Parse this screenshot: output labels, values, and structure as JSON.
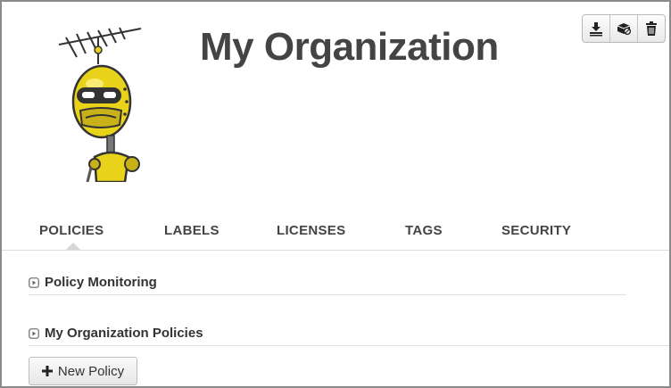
{
  "header": {
    "org_name": "My Organization"
  },
  "toolbar": {
    "icons": [
      "download-icon",
      "license-icon",
      "trash-icon"
    ]
  },
  "tabs": [
    {
      "label": "POLICIES",
      "active": true
    },
    {
      "label": "LABELS",
      "active": false
    },
    {
      "label": "LICENSES",
      "active": false
    },
    {
      "label": "TAGS",
      "active": false
    },
    {
      "label": "SECURITY",
      "active": false
    }
  ],
  "sections": [
    {
      "label": "Policy Monitoring"
    },
    {
      "label": "My Organization Policies"
    }
  ],
  "actions": {
    "new_policy_label": "New Policy"
  },
  "colors": {
    "mascot_yellow": "#e8d21a",
    "text_dark": "#444444"
  }
}
